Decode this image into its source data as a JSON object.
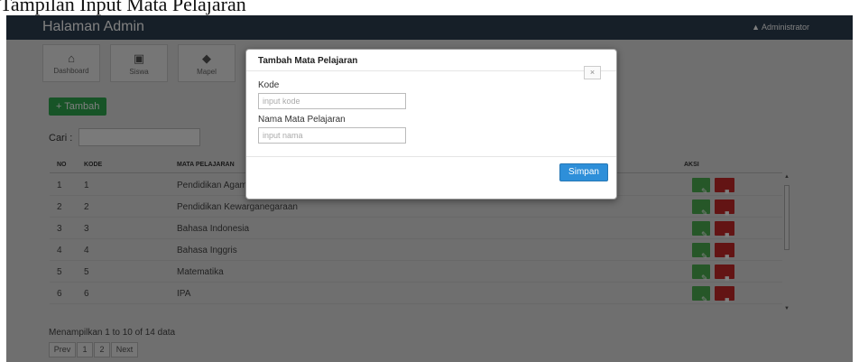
{
  "caption": "Tampilan Input Mata Pelajaran",
  "navbar": {
    "brand": "Halaman Admin",
    "user_icon": "user-icon",
    "user_label": "Administrator"
  },
  "tabs": [
    {
      "label": "Dashboard",
      "icon": "home-icon"
    },
    {
      "label": "Siswa",
      "icon": "students-icon"
    },
    {
      "label": "Mapel",
      "icon": "book-icon"
    }
  ],
  "toolbar": {
    "add_label": "+ Tambah"
  },
  "search": {
    "label": "Cari :",
    "value": ""
  },
  "table": {
    "headers": {
      "no": "NO",
      "kode": "KODE",
      "mapel": "MATA PELAJARAN",
      "aksi": "AKSI"
    },
    "rows": [
      {
        "no": "1",
        "kode": "1",
        "mapel": "Pendidikan Agama"
      },
      {
        "no": "2",
        "kode": "2",
        "mapel": "Pendidikan Kewarganegaraan"
      },
      {
        "no": "3",
        "kode": "3",
        "mapel": "Bahasa Indonesia"
      },
      {
        "no": "4",
        "kode": "4",
        "mapel": "Bahasa Inggris"
      },
      {
        "no": "5",
        "kode": "5",
        "mapel": "Matematika"
      },
      {
        "no": "6",
        "kode": "6",
        "mapel": "IPA"
      }
    ],
    "edit_icon": "edit-icon",
    "delete_icon": "trash-icon"
  },
  "info": "Menampilkan 1 to 10 of 14 data",
  "pagination": {
    "prev": "Prev",
    "pages": [
      "1",
      "2"
    ],
    "next": "Next"
  },
  "modal": {
    "title": "Tambah Mata Pelajaran",
    "close": "×",
    "kode_label": "Kode",
    "kode_placeholder": "input kode",
    "kode_value": "",
    "nama_label": "Nama Mata Pelajaran",
    "nama_placeholder": "input nama",
    "nama_value": "",
    "save_label": "Simpan"
  },
  "colors": {
    "navbar": "#2c3e50",
    "add_button": "#2fa84f",
    "edit_button": "#4caf50",
    "delete_button": "#c62828",
    "save_button": "#2e8fd9"
  }
}
